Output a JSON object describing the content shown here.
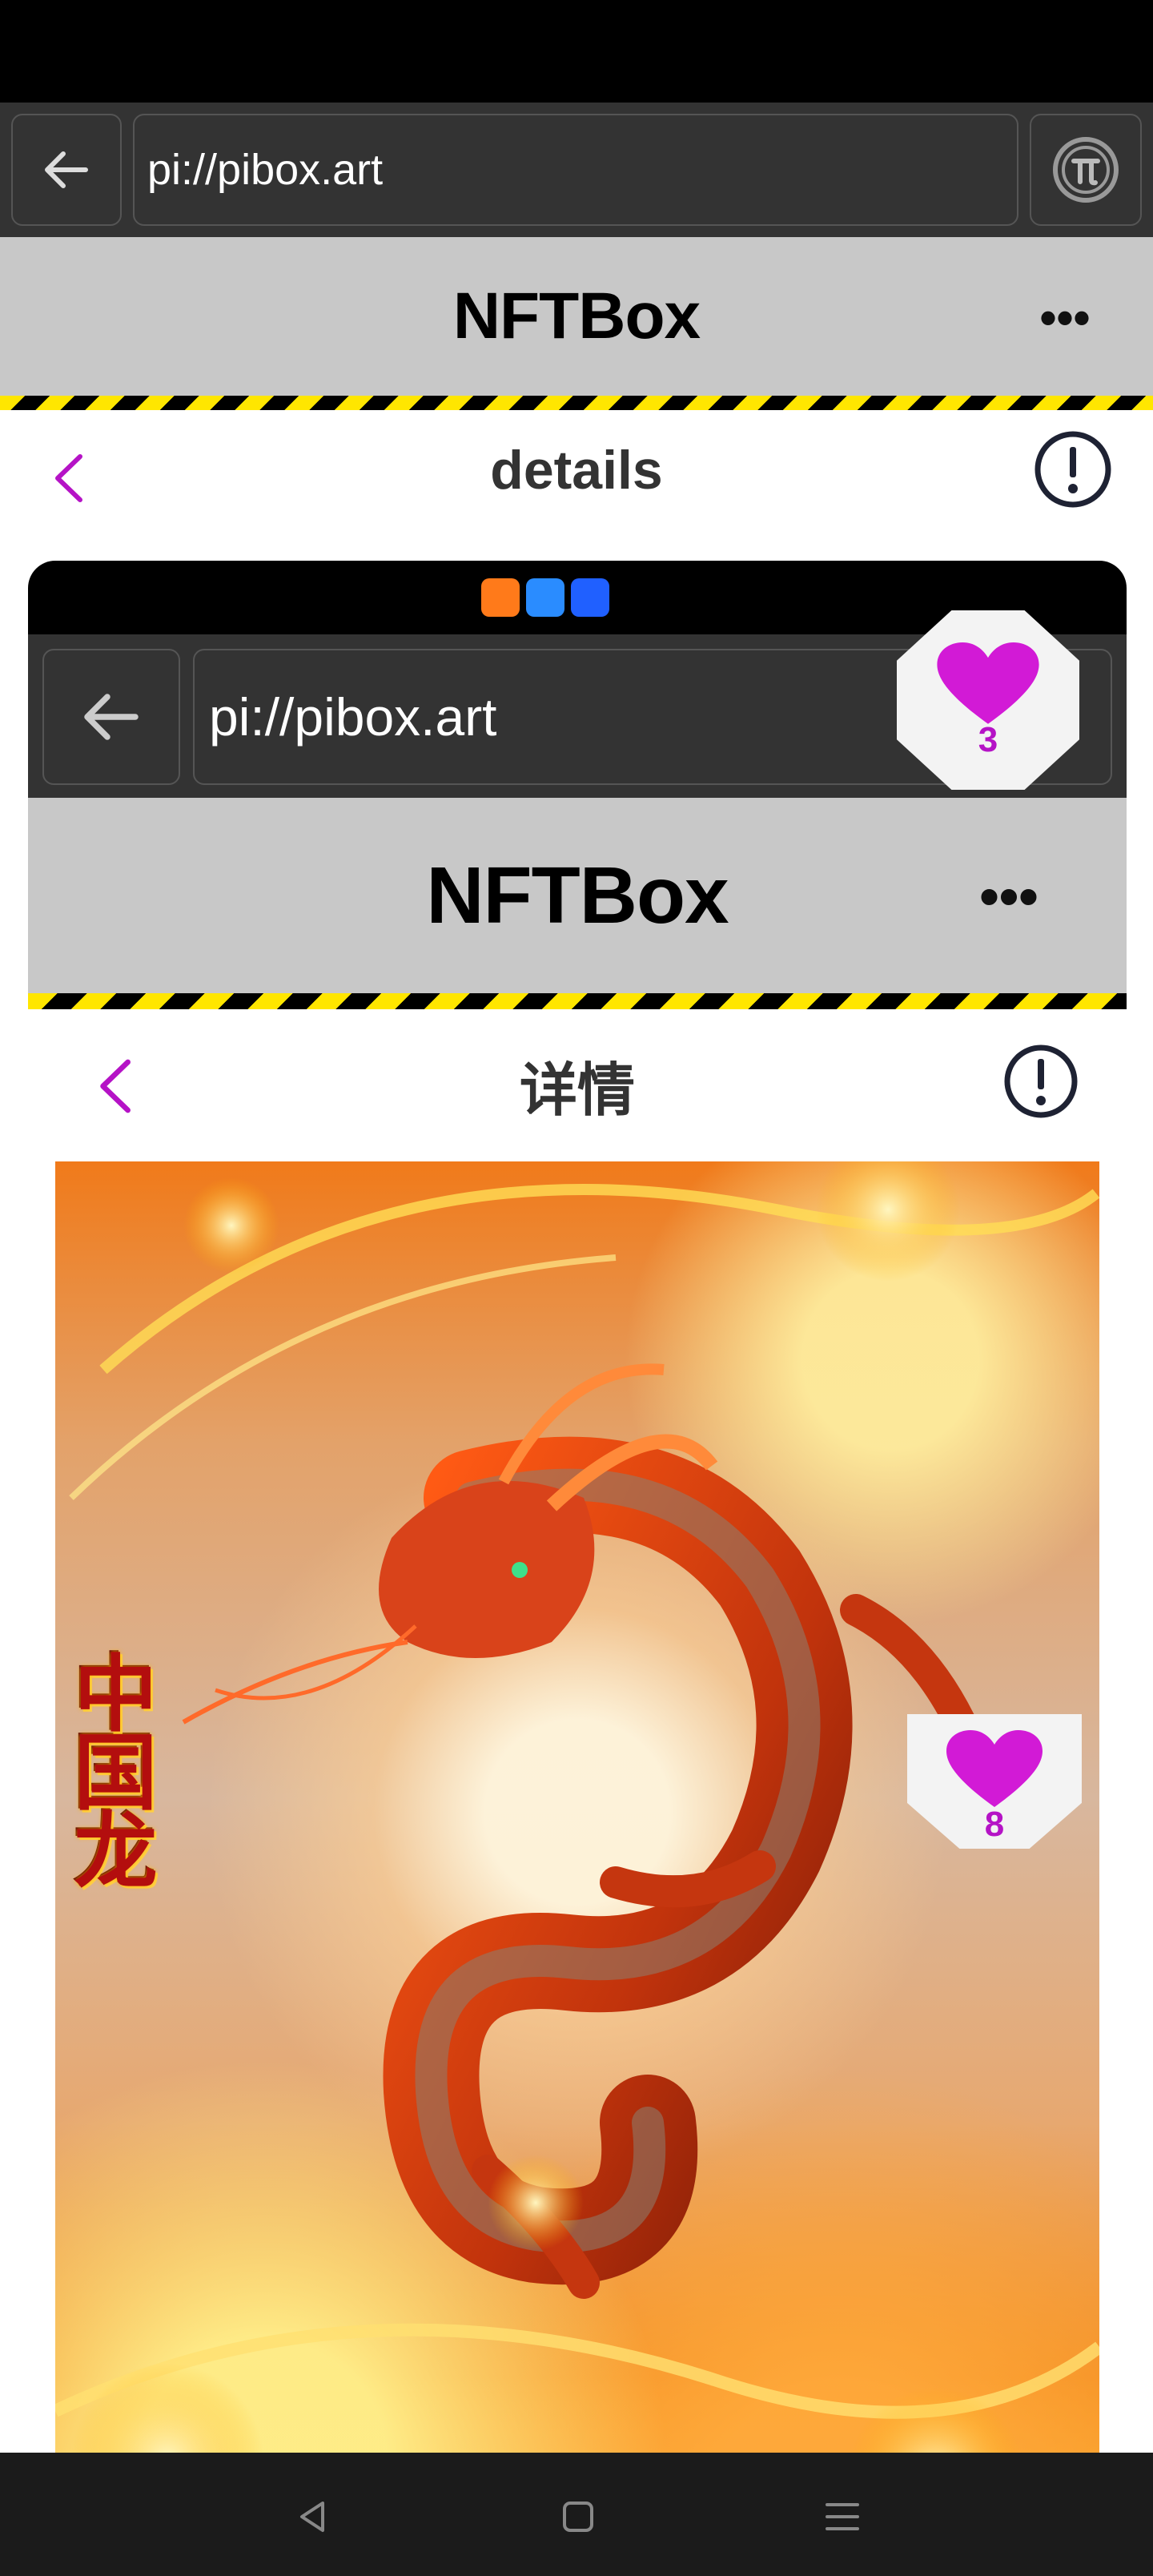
{
  "browser": {
    "url": "pi://pibox.art",
    "back_icon": "arrow-left-icon",
    "pi_icon": "pi-logo-icon"
  },
  "app": {
    "title": "NFTBox",
    "more_label": "•••"
  },
  "details": {
    "title": "details",
    "back_icon": "chevron-left-icon",
    "info_icon": "info-circle-icon"
  },
  "embedded": {
    "browser": {
      "url": "pi://pibox.art"
    },
    "app": {
      "title": "NFTBox",
      "more_label": "•••"
    },
    "details": {
      "title": "详情"
    },
    "artwork": {
      "label": "中国龙",
      "like_count": "8"
    }
  },
  "like_badge": {
    "count": "3"
  },
  "colors": {
    "accent": "#b513c6",
    "heart": "#d21ad6",
    "header_bg": "#c8c8c8",
    "browser_bg": "#333333",
    "hazard_yellow": "#ffe600"
  },
  "nav": {
    "back_icon": "nav-back-icon",
    "home_icon": "nav-home-icon",
    "menu_icon": "nav-menu-icon"
  }
}
